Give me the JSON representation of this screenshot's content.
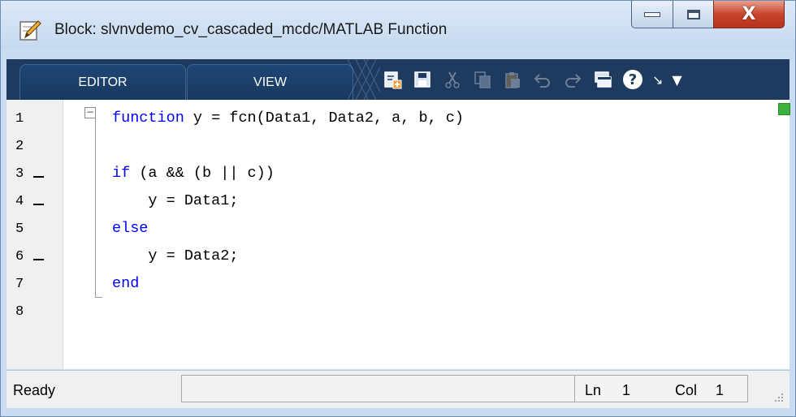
{
  "window": {
    "title": "Block: slvnvdemo_cv_cascaded_mcdc/MATLAB Function",
    "icon": "edit-pencil-icon",
    "controls": {
      "minimize": "minimize-icon",
      "maximize": "maximize-icon",
      "close": "X"
    }
  },
  "tabs": [
    {
      "label": "EDITOR",
      "selected": true
    },
    {
      "label": "VIEW",
      "selected": false
    }
  ],
  "quick_access": [
    {
      "name": "new-script-icon",
      "enabled": true
    },
    {
      "name": "save-icon",
      "enabled": true
    },
    {
      "name": "cut-icon",
      "enabled": false
    },
    {
      "name": "copy-icon",
      "enabled": false
    },
    {
      "name": "paste-icon",
      "enabled": false
    },
    {
      "name": "undo-icon",
      "enabled": false
    },
    {
      "name": "redo-icon",
      "enabled": false
    },
    {
      "name": "switch-windows-icon",
      "enabled": true
    },
    {
      "name": "help-icon",
      "enabled": true,
      "glyph": "?"
    }
  ],
  "ribbon_controls": {
    "minimize_glyph": "↘",
    "customize_glyph": "▼"
  },
  "editor": {
    "lines": [
      {
        "num": "1",
        "bp": false,
        "keyword": "function",
        "rest": " y = fcn(Data1, Data2, a, b, c)"
      },
      {
        "num": "2",
        "bp": false,
        "keyword": "",
        "rest": ""
      },
      {
        "num": "3",
        "bp": true,
        "keyword": "if",
        "rest": " (a && (b || c))"
      },
      {
        "num": "4",
        "bp": true,
        "keyword": "",
        "rest": "    y = Data1;"
      },
      {
        "num": "5",
        "bp": false,
        "keyword": "else",
        "rest": ""
      },
      {
        "num": "6",
        "bp": true,
        "keyword": "",
        "rest": "    y = Data2;"
      },
      {
        "num": "7",
        "bp": false,
        "keyword": "end",
        "rest": ""
      },
      {
        "num": "8",
        "bp": false,
        "keyword": "",
        "rest": ""
      }
    ],
    "analysis_indicator_color": "#3db03d",
    "keyword_color": "#0000ff"
  },
  "status": {
    "text": "Ready",
    "ln_label": "Ln",
    "ln_value": "1",
    "col_label": "Col",
    "col_value": "1"
  }
}
